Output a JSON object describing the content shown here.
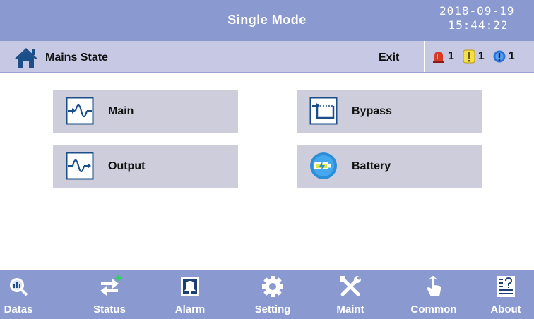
{
  "header": {
    "title": "Single Mode",
    "date": "2018-09-19",
    "time": "15:44:22"
  },
  "subheader": {
    "state_label": "Mains State",
    "exit_label": "Exit",
    "alarms": [
      {
        "icon": "siren-icon",
        "count": "1",
        "color": "#d83a2a"
      },
      {
        "icon": "warning-icon",
        "count": "1",
        "color": "#f2e04a"
      },
      {
        "icon": "info-icon",
        "count": "1",
        "color": "#2a73d8"
      }
    ]
  },
  "tiles": [
    {
      "label": "Main",
      "icon": "waveform-input-icon"
    },
    {
      "label": "Bypass",
      "icon": "bypass-icon"
    },
    {
      "label": "Output",
      "icon": "waveform-output-icon"
    },
    {
      "label": "Battery",
      "icon": "battery-icon"
    }
  ],
  "nav": [
    {
      "label": "Datas",
      "icon": "magnifier-icon"
    },
    {
      "label": "Status",
      "icon": "transfer-arrows-icon"
    },
    {
      "label": "Alarm",
      "icon": "bell-icon"
    },
    {
      "label": "Setting",
      "icon": "gear-icon"
    },
    {
      "label": "Maint",
      "icon": "tools-icon"
    },
    {
      "label": "Common",
      "icon": "pointer-hand-icon"
    },
    {
      "label": "About",
      "icon": "about-icon"
    }
  ],
  "colors": {
    "bar": "#8a9ad0",
    "subbar": "#c7c9e4",
    "tile": "#cdcddc",
    "icon_blue": "#1a4f8a"
  }
}
